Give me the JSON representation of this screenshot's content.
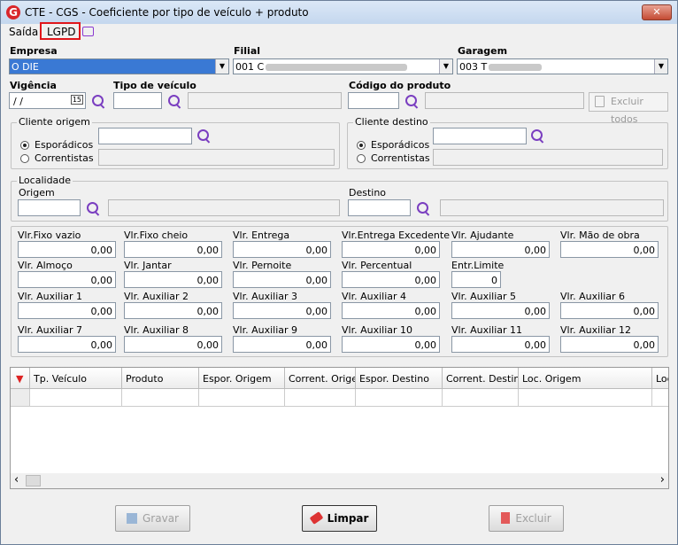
{
  "window": {
    "title": "CTE - CGS - Coeficiente por tipo de veículo + produto",
    "app_icon_letter": "G",
    "close_glyph": "✕"
  },
  "menu": {
    "exit": "Saída",
    "lgpd": "LGPD"
  },
  "header": {
    "empresa_label": "Empresa",
    "empresa_value": "O DIE",
    "filial_label": "Filial",
    "filial_value": "001 C",
    "garagem_label": "Garagem",
    "garagem_value": "003 T"
  },
  "row2": {
    "vigencia_label": "Vigência",
    "vigencia_value": " / /",
    "calendar_glyph": "15",
    "tipo_label": "Tipo de veículo",
    "codigo_label": "Código do produto",
    "excluir_todos": "Excluir todos"
  },
  "cliente_origem": {
    "title": "Cliente origem",
    "opt1": "Esporádicos",
    "opt2": "Correntistas"
  },
  "cliente_destino": {
    "title": "Cliente destino",
    "opt1": "Esporádicos",
    "opt2": "Correntistas"
  },
  "localidade": {
    "title": "Localidade",
    "origem": "Origem",
    "destino": "Destino"
  },
  "values": [
    {
      "label": "Vlr.Fixo vazio",
      "value": "0,00"
    },
    {
      "label": "Vlr.Fixo cheio",
      "value": "0,00"
    },
    {
      "label": "Vlr. Entrega",
      "value": "0,00"
    },
    {
      "label": "Vlr.Entrega Excedente",
      "value": "0,00"
    },
    {
      "label": "Vlr. Ajudante",
      "value": "0,00"
    },
    {
      "label": "Vlr. Mão de obra",
      "value": "0,00"
    },
    {
      "label": "Vlr. Almoço",
      "value": "0,00"
    },
    {
      "label": "Vlr. Jantar",
      "value": "0,00"
    },
    {
      "label": "Vlr. Pernoite",
      "value": "0,00"
    },
    {
      "label": "Vlr. Percentual",
      "value": "0,00"
    },
    {
      "label": "Entr.Limite",
      "value": "0"
    },
    {
      "label": "Vlr. Auxiliar 1",
      "value": "0,00"
    },
    {
      "label": "Vlr. Auxiliar 2",
      "value": "0,00"
    },
    {
      "label": "Vlr. Auxiliar 3",
      "value": "0,00"
    },
    {
      "label": "Vlr. Auxiliar 4",
      "value": "0,00"
    },
    {
      "label": "Vlr. Auxiliar 5",
      "value": "0,00"
    },
    {
      "label": "Vlr. Auxiliar 6",
      "value": "0,00"
    },
    {
      "label": "Vlr. Auxiliar 7",
      "value": "0,00"
    },
    {
      "label": "Vlr. Auxiliar 8",
      "value": "0,00"
    },
    {
      "label": "Vlr. Auxiliar 9",
      "value": "0,00"
    },
    {
      "label": "Vlr. Auxiliar 10",
      "value": "0,00"
    },
    {
      "label": "Vlr. Auxiliar 11",
      "value": "0,00"
    },
    {
      "label": "Vlr. Auxiliar 12",
      "value": "0,00"
    }
  ],
  "grid": {
    "columns": [
      "Tp. Veículo",
      "Produto",
      "Espor. Origem",
      "Corrent. Origem",
      "Espor. Destino",
      "Corrent. Destino",
      "Loc. Origem",
      "Loc"
    ],
    "scroll_left": "‹",
    "scroll_right": "›"
  },
  "buttons": {
    "gravar": "Gravar",
    "limpar": "Limpar",
    "excluir": "Excluir"
  },
  "colors": {
    "highlight_box": "#e0161b",
    "search_icon": "#7a3ec0",
    "selected_field": "#3a79d4"
  }
}
